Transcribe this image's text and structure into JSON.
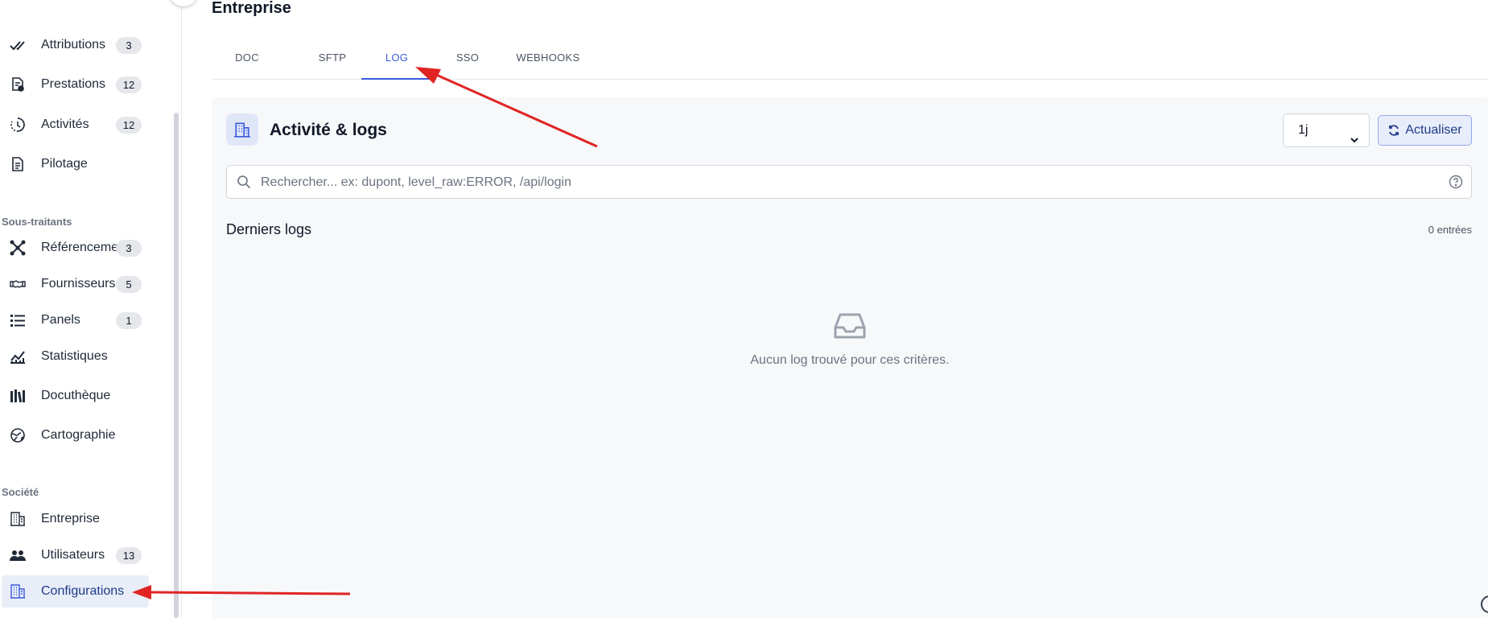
{
  "sidebar": {
    "items": [
      {
        "label": "Attributions",
        "badge": "3",
        "icon": "double-check-icon"
      },
      {
        "label": "Prestations",
        "badge": "12",
        "icon": "document-gear-icon"
      },
      {
        "label": "Activités",
        "badge": "12",
        "icon": "clock-history-icon"
      },
      {
        "label": "Pilotage",
        "badge": "",
        "icon": "document-icon"
      }
    ],
    "sections": [
      {
        "title": "Sous-traitants",
        "items": [
          {
            "label": "Référencements",
            "badge": "3",
            "icon": "network-icon"
          },
          {
            "label": "Fournisseurs",
            "badge": "5",
            "icon": "handshake-icon"
          },
          {
            "label": "Panels",
            "badge": "1",
            "icon": "list-icon"
          },
          {
            "label": "Statistiques",
            "badge": "",
            "icon": "chart-line-icon"
          },
          {
            "label": "Docuthèque",
            "badge": "",
            "icon": "library-icon"
          },
          {
            "label": "Cartographie",
            "badge": "",
            "icon": "globe-icon"
          }
        ]
      },
      {
        "title": "Société",
        "items": [
          {
            "label": "Entreprise",
            "badge": "",
            "icon": "building-icon"
          },
          {
            "label": "Utilisateurs",
            "badge": "13",
            "icon": "users-icon"
          },
          {
            "label": "Configurations",
            "badge": "",
            "icon": "building-icon",
            "active": true
          }
        ]
      }
    ]
  },
  "header": {
    "title": "Entreprise"
  },
  "tabs": [
    {
      "label": "DOC",
      "active": false
    },
    {
      "label": "SFTP",
      "active": false
    },
    {
      "label": "LOG",
      "active": true
    },
    {
      "label": "SSO",
      "active": false
    },
    {
      "label": "WEBHOOKS",
      "active": false
    }
  ],
  "card": {
    "title": "Activité & logs",
    "period": {
      "selected": "1j"
    },
    "refresh_label": "Actualiser",
    "search": {
      "placeholder": "Rechercher... ex: dupont, level_raw:ERROR, /api/login",
      "value": ""
    },
    "section_title": "Derniers logs",
    "entries_count": "0 entrées",
    "empty_message": "Aucun log trouvé pour ces critères."
  },
  "colors": {
    "accent": "#3b5bdb",
    "annotation_arrow": "#e02424"
  }
}
